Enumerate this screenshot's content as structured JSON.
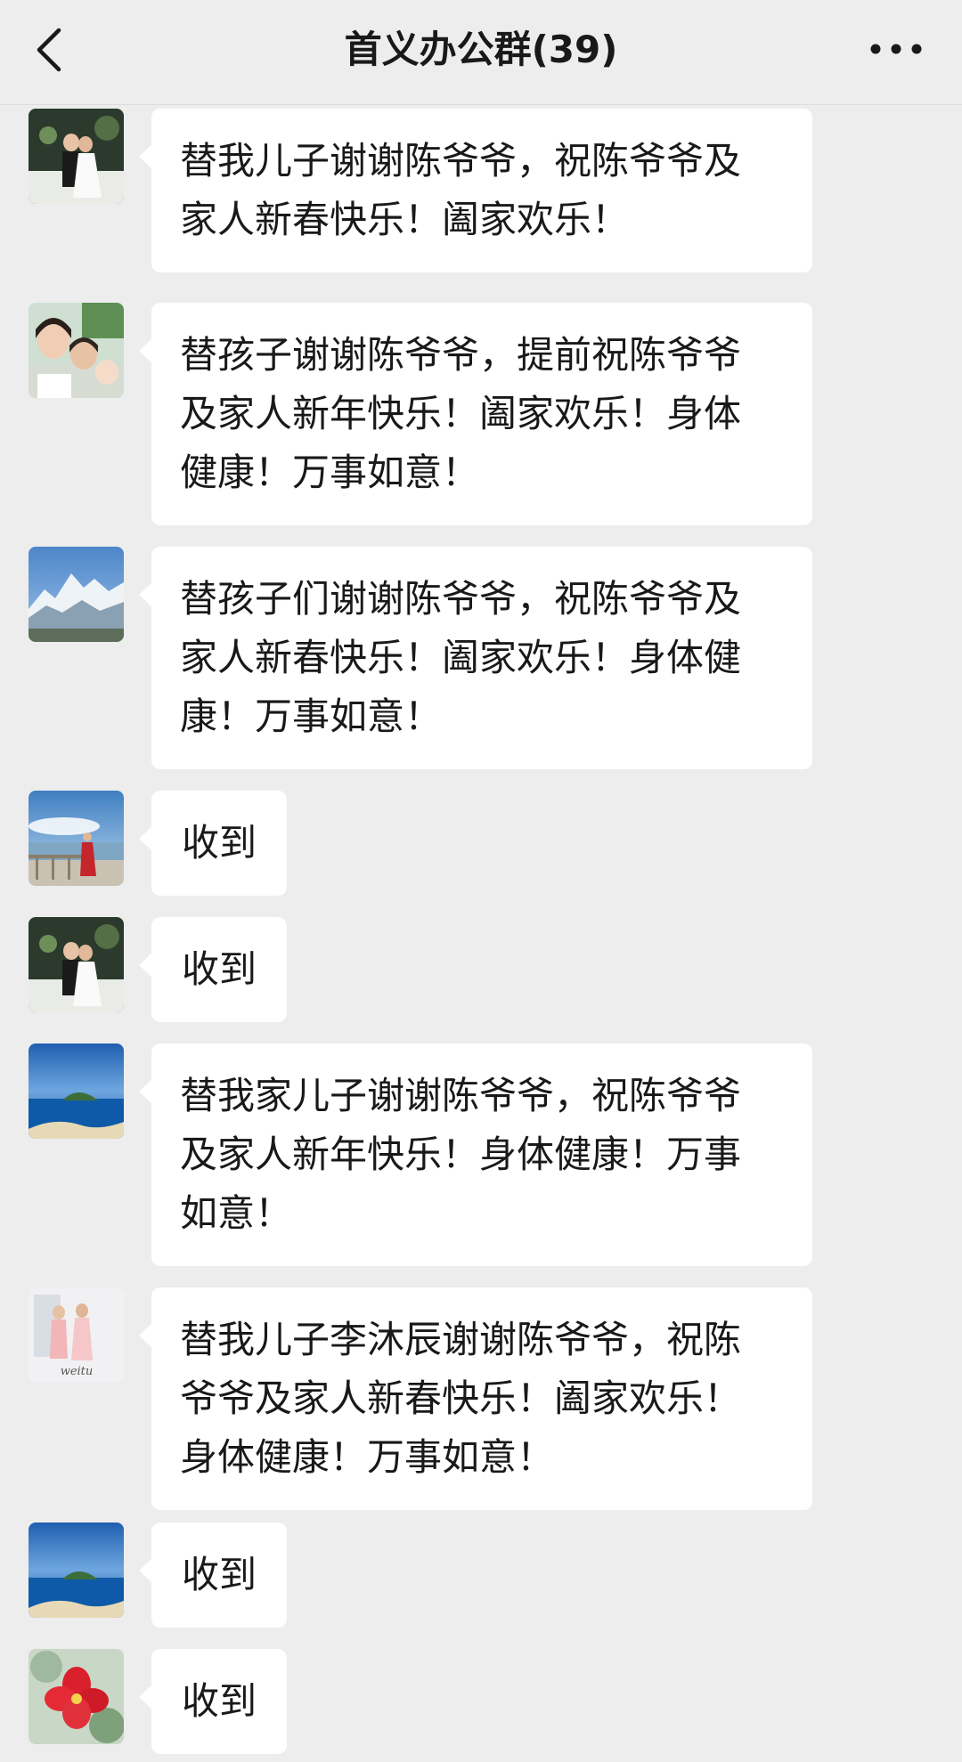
{
  "header": {
    "title": "首义办公群(39)",
    "back_icon": "chevron-left-icon",
    "more_icon": "more-horizontal-icon"
  },
  "messages": [
    {
      "avatar": "wedding-couple",
      "text": "替我儿子谢谢陈爷爷，祝陈爷爷及\n家人新春快乐！阖家欢乐！"
    },
    {
      "avatar": "family-selfie",
      "text": "替孩子谢谢陈爷爷，提前祝陈爷爷\n及家人新年快乐！阖家欢乐！身体\n健康！万事如意！"
    },
    {
      "avatar": "snow-mountain",
      "text": "替孩子们谢谢陈爷爷，祝陈爷爷及\n家人新春快乐！阖家欢乐！身体健\n康！万事如意！"
    },
    {
      "avatar": "seaside-red-dress",
      "text": "收到"
    },
    {
      "avatar": "wedding-couple",
      "text": "收到"
    },
    {
      "avatar": "island-sea",
      "text": "替我家儿子谢谢陈爷爷，祝陈爷爷\n及家人新年快乐！身体健康！万事\n如意！"
    },
    {
      "avatar": "pink-couple",
      "text": "替我儿子李沐辰谢谢陈爷爷，祝陈\n爷爷及家人新春快乐！阖家欢乐！\n身体健康！万事如意！"
    },
    {
      "avatar": "island-sea",
      "text": "收到"
    },
    {
      "avatar": "red-flower",
      "text": "收到"
    }
  ],
  "colors": {
    "background": "#ededed",
    "bubble": "#ffffff",
    "text": "#191919"
  }
}
